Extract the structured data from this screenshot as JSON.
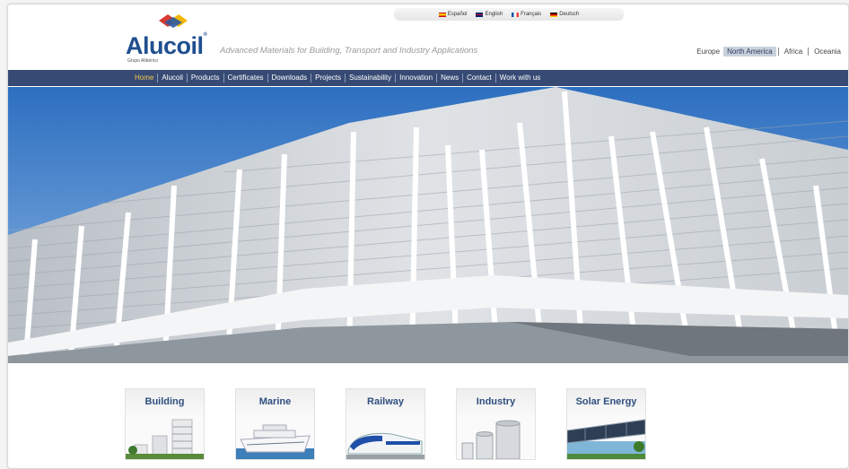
{
  "languages": [
    {
      "label": "Español",
      "flag": "es"
    },
    {
      "label": "English",
      "flag": "en"
    },
    {
      "label": "Français",
      "flag": "fr"
    },
    {
      "label": "Deutsch",
      "flag": "de"
    }
  ],
  "brand": {
    "name": "Alucoil",
    "registered": "®",
    "group": "Grupo Alibérico",
    "tagline": "Advanced Materials for Building, Transport and Industry Applications"
  },
  "regions": [
    "Europe",
    "North America",
    "Africa",
    "Oceania"
  ],
  "nav": [
    "Home",
    "Alucoil",
    "Products",
    "Certificates",
    "Downloads",
    "Projects",
    "Sustainability",
    "Innovation",
    "News",
    "Contact",
    "Work with us"
  ],
  "categories": [
    "Building",
    "Marine",
    "Railway",
    "Industry",
    "Solar Energy"
  ],
  "colors": {
    "brand": "#1f4f8f",
    "nav": "#374a74",
    "nav_active": "#f2c84b",
    "region_active": "#c9d1dd"
  }
}
